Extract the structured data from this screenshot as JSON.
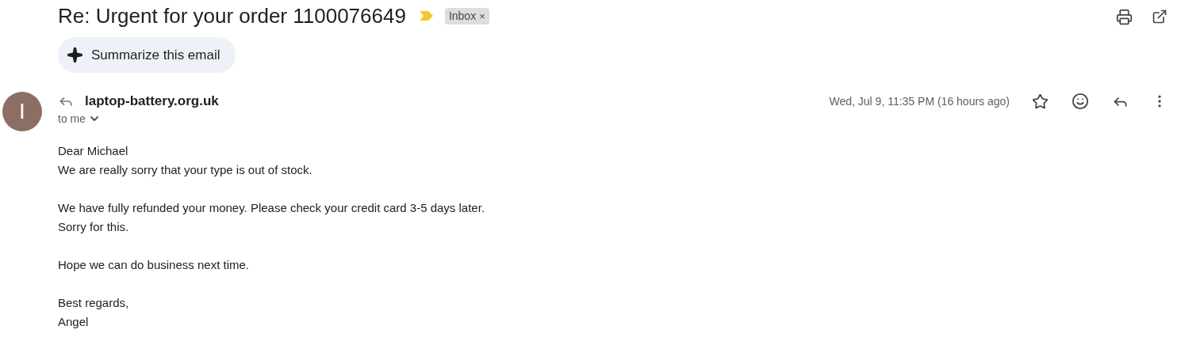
{
  "subject": "Re: Urgent for your order 1100076649",
  "important": true,
  "label": {
    "text": "Inbox",
    "remove": "×"
  },
  "summarize_button": "Summarize this email",
  "sender": {
    "avatar_letter": "I",
    "name": "laptop-battery.org.uk",
    "recipient": "to me"
  },
  "date": "Wed, Jul 9, 11:35 PM (16 hours ago)",
  "starred": false,
  "body": [
    [
      "Dear Michael",
      "We are really sorry that your type is out of stock."
    ],
    [
      "We have fully refunded your money. Please check your credit card 3-5 days later.",
      "Sorry for this."
    ],
    [
      "Hope we can do business next time."
    ],
    [
      "Best regards,",
      "Angel"
    ]
  ]
}
